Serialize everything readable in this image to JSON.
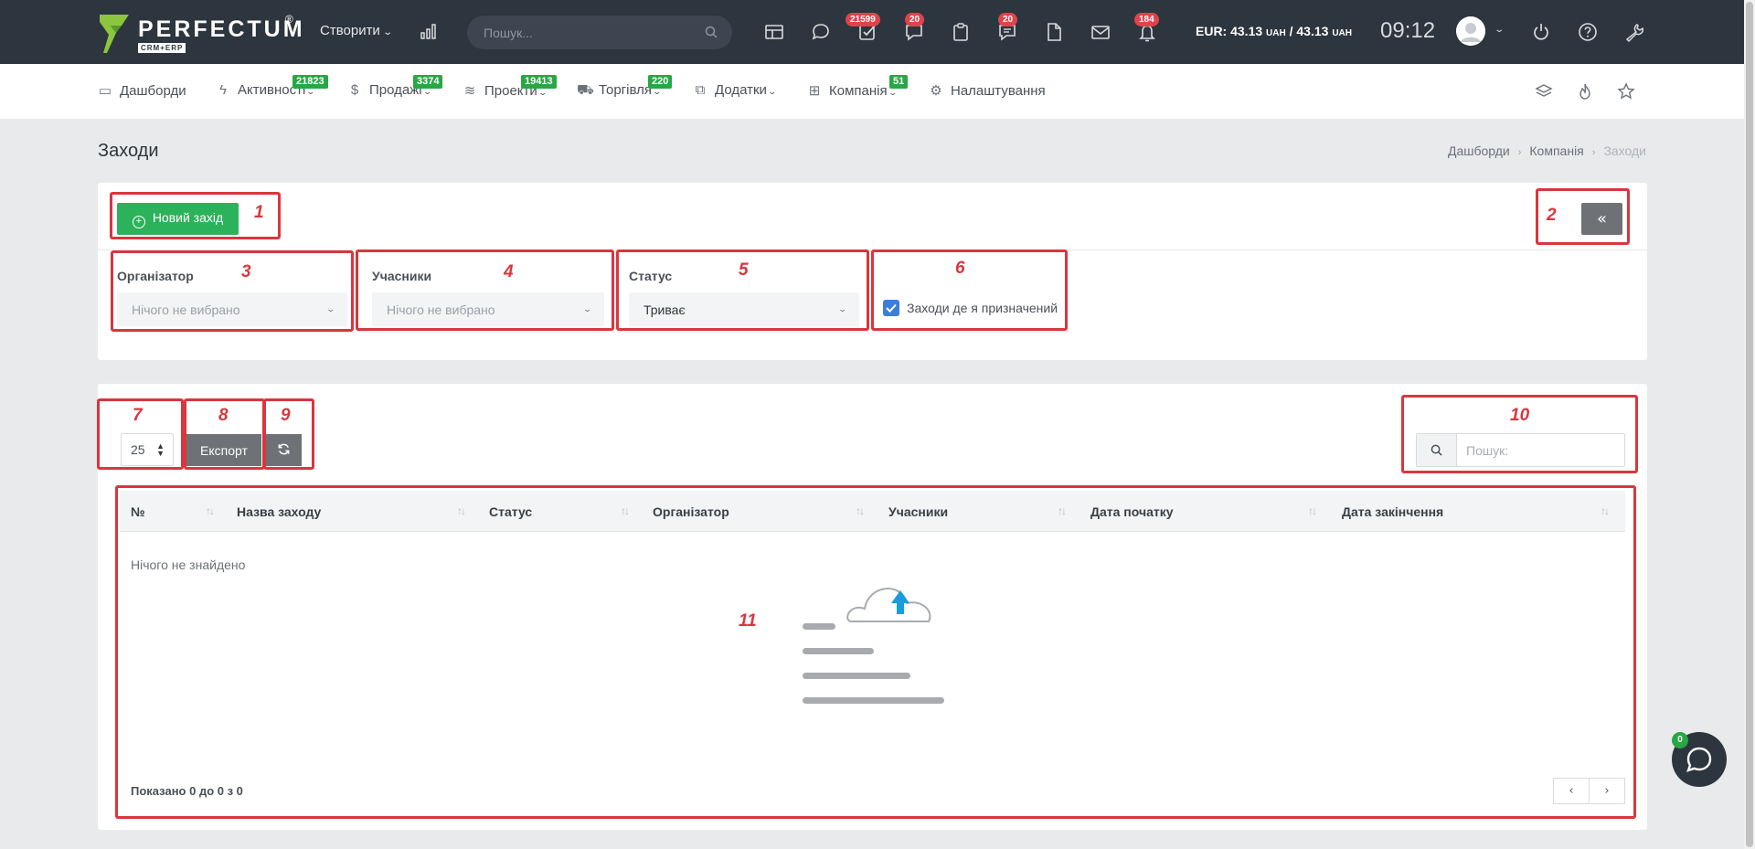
{
  "topbar": {
    "logo_text": "PERFECTUM",
    "logo_sub": "CRM+ERP",
    "logo_reg": "®",
    "create_label": "Створити",
    "search_placeholder": "Пошук...",
    "badges": {
      "tasks": "21599",
      "chat": "20",
      "messages": "20",
      "notifications": "184"
    },
    "currency_label": "EUR: 43.13",
    "currency_unit1": "UAH",
    "currency_sep": " / 43.13 ",
    "currency_unit2": "UAH",
    "time": "09:12"
  },
  "nav": {
    "items": [
      {
        "label": "Дашборди",
        "badge": ""
      },
      {
        "label": "Активності",
        "badge": "21823"
      },
      {
        "label": "Продажі",
        "badge": "3374"
      },
      {
        "label": "Проекти",
        "badge": "19413"
      },
      {
        "label": "Торгівля",
        "badge": "220"
      },
      {
        "label": "Додатки",
        "badge": ""
      },
      {
        "label": "Компанія",
        "badge": "51"
      },
      {
        "label": "Налаштування",
        "badge": ""
      }
    ]
  },
  "page": {
    "title": "Заходи",
    "breadcrumb": [
      "Дашборди",
      "Компанія",
      "Заходи"
    ]
  },
  "filters": {
    "new_button": "Новий захід",
    "collapse_label": "«",
    "organizer_label": "Організатор",
    "organizer_value": "Нічого не вибрано",
    "participants_label": "Учасники",
    "participants_value": "Нічого не вибрано",
    "status_label": "Статус",
    "status_value": "Триває",
    "assigned_label": "Заходи де я призначений",
    "assigned_checked": true
  },
  "table": {
    "page_size": "25",
    "export_label": "Експорт",
    "search_placeholder": "Пошук:",
    "columns": [
      "№",
      "Назва заходу",
      "Статус",
      "Організатор",
      "Учасники",
      "Дата початку",
      "Дата закінчення"
    ],
    "empty_text": "Нічого не знайдено",
    "summary": "Показано 0 до 0 з 0",
    "prev_label": "‹",
    "next_label": "›"
  },
  "annotations": [
    "1",
    "2",
    "3",
    "4",
    "5",
    "6",
    "7",
    "8",
    "9",
    "10",
    "11"
  ],
  "chat": {
    "badge": "0"
  },
  "colors": {
    "accent_green": "#2cb25a",
    "annotation_red": "#d9363e",
    "topbar": "#2d353e",
    "badge_red": "#e0434b",
    "badge_green": "#28a745",
    "checkbox_blue": "#3b7ddd"
  }
}
